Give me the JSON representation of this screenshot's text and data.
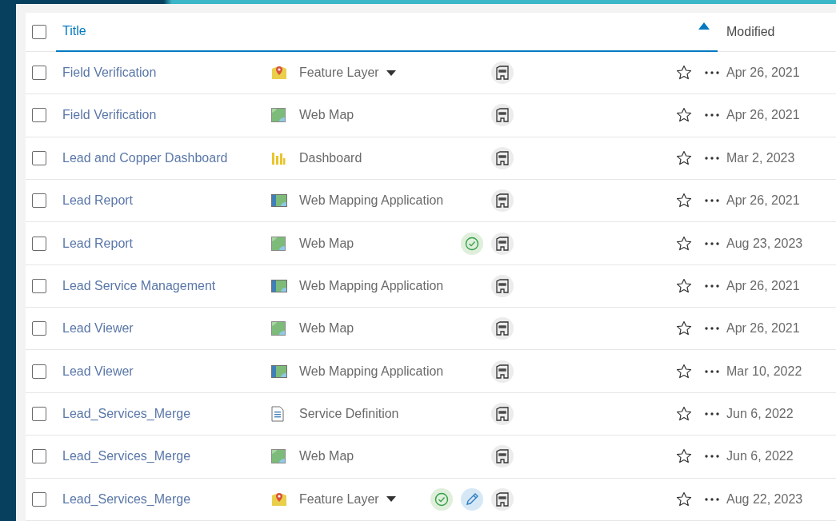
{
  "header": {
    "select_all": {
      "checked": false
    },
    "columns": [
      {
        "label": "Title",
        "sorted": true
      },
      {
        "label": "Modified",
        "sorted": false
      }
    ]
  },
  "rows": [
    {
      "checked": false,
      "title": "Field Verification",
      "kind": "feature-layer",
      "type": "Feature Layer",
      "has_menu": true,
      "authoritative": false,
      "editable": false,
      "favorite": false,
      "modified": "Apr 26, 2021"
    },
    {
      "checked": false,
      "title": "Field Verification",
      "kind": "web-map",
      "type": "Web Map",
      "has_menu": false,
      "authoritative": false,
      "editable": false,
      "favorite": false,
      "modified": "Apr 26, 2021"
    },
    {
      "checked": false,
      "title": "Lead and Copper Dashboard",
      "kind": "dashboard",
      "type": "Dashboard",
      "has_menu": false,
      "authoritative": false,
      "editable": false,
      "favorite": false,
      "modified": "Mar 2, 2023"
    },
    {
      "checked": false,
      "title": "Lead Report",
      "kind": "web-app",
      "type": "Web Mapping Application",
      "has_menu": false,
      "authoritative": false,
      "editable": false,
      "favorite": false,
      "modified": "Apr 26, 2021"
    },
    {
      "checked": false,
      "title": "Lead Report",
      "kind": "web-map",
      "type": "Web Map",
      "has_menu": false,
      "authoritative": true,
      "editable": false,
      "favorite": false,
      "modified": "Aug 23, 2023"
    },
    {
      "checked": false,
      "title": "Lead Service Management",
      "kind": "web-app",
      "type": "Web Mapping Application",
      "has_menu": false,
      "authoritative": false,
      "editable": false,
      "favorite": false,
      "modified": "Apr 26, 2021"
    },
    {
      "checked": false,
      "title": "Lead Viewer",
      "kind": "web-map",
      "type": "Web Map",
      "has_menu": false,
      "authoritative": false,
      "editable": false,
      "favorite": false,
      "modified": "Apr 26, 2021"
    },
    {
      "checked": false,
      "title": "Lead Viewer",
      "kind": "web-app",
      "type": "Web Mapping Application",
      "has_menu": false,
      "authoritative": false,
      "editable": false,
      "favorite": false,
      "modified": "Mar 10, 2022"
    },
    {
      "checked": false,
      "title": "Lead_Services_Merge",
      "kind": "service-definition",
      "type": "Service Definition",
      "has_menu": false,
      "authoritative": false,
      "editable": false,
      "favorite": false,
      "modified": "Jun 6, 2022"
    },
    {
      "checked": false,
      "title": "Lead_Services_Merge",
      "kind": "web-map",
      "type": "Web Map",
      "has_menu": false,
      "authoritative": false,
      "editable": false,
      "favorite": false,
      "modified": "Jun 6, 2022"
    },
    {
      "checked": false,
      "title": "Lead_Services_Merge",
      "kind": "feature-layer",
      "type": "Feature Layer",
      "has_menu": true,
      "authoritative": true,
      "editable": true,
      "favorite": false,
      "modified": "Aug 22, 2023"
    }
  ]
}
